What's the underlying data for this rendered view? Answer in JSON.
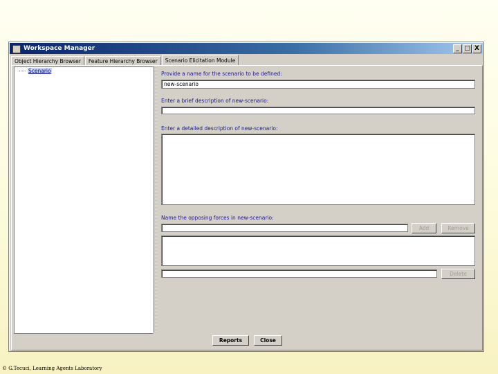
{
  "window": {
    "title": "Workspace Manager",
    "controls": [
      "_",
      "□",
      "X"
    ]
  },
  "tabs": [
    {
      "label": "Object Hierarchy Browser",
      "active": false
    },
    {
      "label": "Feature Hierarchy Browser",
      "active": false
    },
    {
      "label": "Scenario Elicitation Module",
      "active": true
    }
  ],
  "tree": {
    "items": [
      {
        "label": "Scenario"
      }
    ]
  },
  "form": {
    "name_label": "Provide a name for the scenario to be defined:",
    "name_value": "new-scenario",
    "brief_label": "Enter a brief description of new-scenario:",
    "brief_value": "",
    "detailed_label": "Enter a detailed description of new-scenario:",
    "detailed_value": "",
    "forces_label": "Name the opposing forces in new-scenario:",
    "forces_value": "",
    "add_label": "Add",
    "remove_label": "Remove",
    "delete_label": "Delete"
  },
  "bottom_buttons": {
    "reports": "Reports",
    "close": "Close"
  },
  "footer": {
    "text": "© G.Tecuci, Learning Agents Laboratory"
  },
  "colors": {
    "title_bar": "#0a246a",
    "label_text": "#1a1a8c",
    "window_bg": "#d4d0c8"
  }
}
